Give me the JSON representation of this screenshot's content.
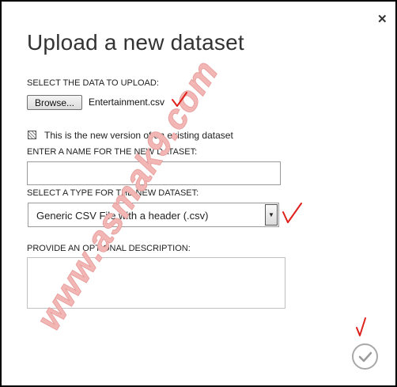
{
  "dialog": {
    "title": "Upload a new dataset",
    "close_icon": "close-icon",
    "select_data_label": "SELECT THE DATA TO UPLOAD:",
    "browse_label": "Browse...",
    "selected_file": "Entertainment.csv",
    "new_version_label": "This is the new version of an existing dataset",
    "new_version_checked": false,
    "name_label": "ENTER A NAME FOR THE NEW DATASET:",
    "name_value": "",
    "type_label": "SELECT A TYPE FOR THE NEW DATASET:",
    "type_value": "Generic CSV File with a header (.csv)",
    "description_label": "PROVIDE AN OPTIONAL DESCRIPTION:",
    "description_value": "",
    "ok_icon": "checkmark-icon"
  },
  "annotations": {
    "watermark_text": "www.asmak9.com",
    "mark_color": "#e0201a",
    "watermark_color": "#f2b7b5"
  }
}
